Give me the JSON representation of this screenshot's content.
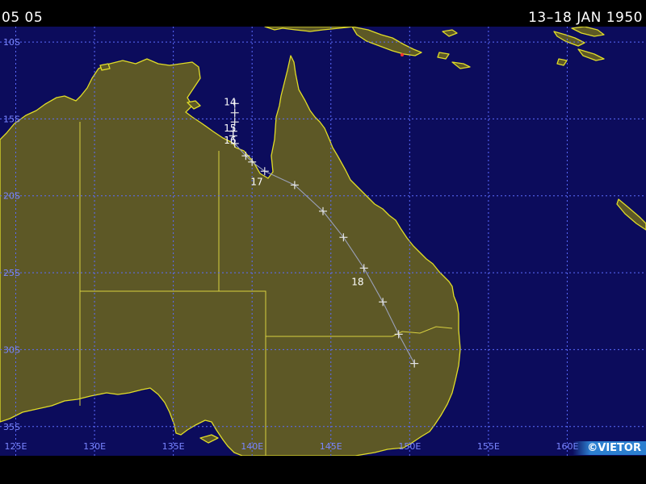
{
  "header": {
    "time": "05 05",
    "period": "13–18 JAN 1950"
  },
  "credit": "©VIETOR",
  "colors": {
    "ocean": "#0c0c5c",
    "land": "#5d5826",
    "coast": "#e0dc28",
    "grid": "#5c6cff",
    "track": "#9aa0b8"
  },
  "map": {
    "lon_min": 124,
    "lon_max": 165,
    "lat_max": -9,
    "lat_min": -36.9,
    "lon_labels": [
      "125E",
      "130E",
      "135E",
      "140E",
      "145E",
      "150E",
      "155E",
      "160E"
    ],
    "lat_labels": [
      "10S",
      "15S",
      "20S",
      "25S",
      "30S",
      "35S"
    ],
    "lon_values": [
      125,
      130,
      135,
      140,
      145,
      150,
      155,
      160
    ],
    "lat_values": [
      -10,
      -15,
      -20,
      -25,
      -30,
      -35
    ]
  },
  "storm": {
    "track": [
      [
        138.9,
        -14.0
      ],
      [
        138.9,
        -14.6
      ],
      [
        138.9,
        -15.2
      ],
      [
        138.8,
        -15.8
      ],
      [
        138.8,
        -16.1
      ],
      [
        138.9,
        -16.6
      ],
      [
        139.6,
        -17.4
      ],
      [
        140.0,
        -17.8
      ],
      [
        140.8,
        -18.4
      ],
      [
        142.7,
        -19.3
      ],
      [
        144.5,
        -21.0
      ],
      [
        145.8,
        -22.7
      ],
      [
        147.1,
        -24.7
      ],
      [
        148.3,
        -26.9
      ],
      [
        149.3,
        -29.0
      ],
      [
        150.3,
        -30.9
      ]
    ],
    "day_labels": [
      {
        "text": "14",
        "lon": 138.6,
        "lat": -13.9
      },
      {
        "text": "15",
        "lon": 138.6,
        "lat": -15.6
      },
      {
        "text": "16",
        "lon": 138.6,
        "lat": -16.4
      },
      {
        "text": "17",
        "lon": 140.3,
        "lat": -19.1
      },
      {
        "text": "18",
        "lon": 146.7,
        "lat": -25.6
      }
    ]
  }
}
